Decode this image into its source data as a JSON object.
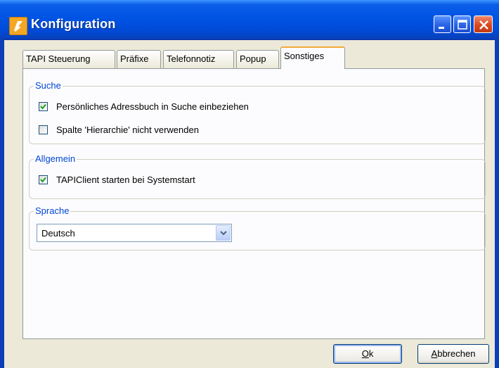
{
  "window": {
    "title": "Konfiguration"
  },
  "tabs": [
    {
      "label": "TAPI Steuerung"
    },
    {
      "label": "Präfixe"
    },
    {
      "label": "Telefonnotiz"
    },
    {
      "label": "Popup"
    },
    {
      "label": "Sonstiges",
      "active": true
    }
  ],
  "groups": {
    "suche": {
      "title": "Suche",
      "options": [
        {
          "label": "Persönliches Adressbuch in Suche einbeziehen",
          "checked": true
        },
        {
          "label": "Spalte 'Hierarchie' nicht verwenden",
          "checked": false
        }
      ]
    },
    "allgemein": {
      "title": "Allgemein",
      "options": [
        {
          "label": "TAPIClient starten bei Systemstart",
          "checked": true
        }
      ]
    },
    "sprache": {
      "title": "Sprache",
      "selected": "Deutsch"
    }
  },
  "buttons": {
    "ok_underline": "O",
    "ok_rest": "k",
    "cancel_underline": "A",
    "cancel_rest": "bbrechen"
  },
  "colors": {
    "accent": "#0046d5",
    "titlebar": "#0054e3",
    "active_tab": "#f2a938"
  },
  "icons": {
    "app": "app-logo-icon",
    "check": "check-icon",
    "dropdown": "chevron-down-icon"
  }
}
